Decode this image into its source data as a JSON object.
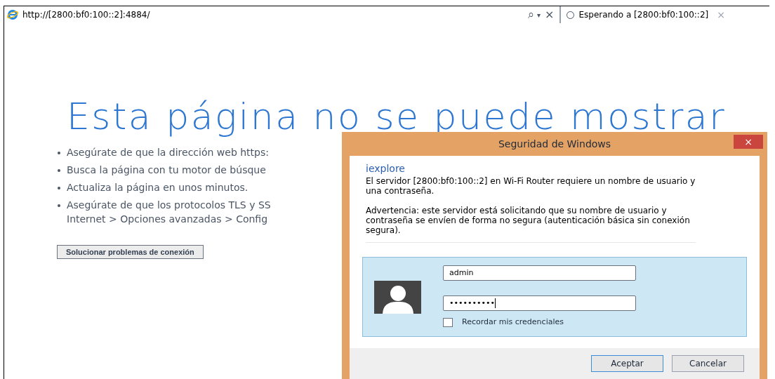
{
  "browser": {
    "address": "http://[2800:bf0:100::2]:4884/",
    "search_glyph": "⌕",
    "dropdown_glyph": "▾",
    "stop_glyph": "×",
    "tab": {
      "title": "Esperando a [2800:bf0:100::2]",
      "close_glyph": "×",
      "loading": true
    }
  },
  "page": {
    "heading": "Esta página no se puede mostrar",
    "bullets": [
      {
        "lines": [
          "Asegúrate de que la dirección web https:"
        ]
      },
      {
        "lines": [
          "Busca la página con tu motor de búsque"
        ]
      },
      {
        "lines": [
          "Actualiza la página en unos minutos."
        ]
      },
      {
        "lines": [
          "Asegúrate de que los protocolos TLS y SS",
          "Internet > Opciones avanzadas > Config"
        ]
      }
    ],
    "button": "Solucionar problemas de conexión"
  },
  "dialog": {
    "title": "Seguridad de Windows",
    "close_glyph": "×",
    "app": "iexplore",
    "message": "El servidor [2800:bf0:100::2] en Wi-Fi Router requiere un nombre de usuario y una contraseña.",
    "warning": "Advertencia: este servidor está solicitando que su nombre de usuario y contraseña se envíen de forma no segura (autenticación básica sin conexión segura).",
    "username": {
      "value": "admin"
    },
    "password": {
      "value": "••••••••••",
      "focused": true
    },
    "remember": {
      "label": "Recordar mis credenciales",
      "checked": false
    },
    "buttons": [
      {
        "label": "Aceptar",
        "default": true
      },
      {
        "label": "Cancelar",
        "default": false
      }
    ]
  }
}
